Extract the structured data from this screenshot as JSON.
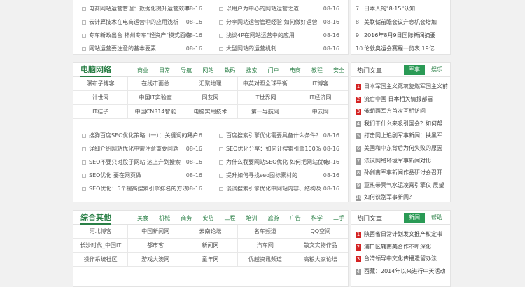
{
  "top_section": {
    "rows": [
      {
        "left": "电商网站运营管理：数据化提升运营效率",
        "left_date": "08-16",
        "right": "以用户为中心的网站运营之道",
        "right_date": "08-16"
      },
      {
        "left": "云计算技术在电商运营中的应用浅析",
        "left_date": "08-16",
        "right": "分享网站运营管理经验 如何做好运营",
        "right_date": "08-16"
      },
      {
        "left": "专车新政出台 神州专车\"轻资产\"模式面临",
        "left_date": "08-16",
        "right": "浅谈4P在网站运营中的应用",
        "right_date": "08-16"
      },
      {
        "left": "网站运营要注意的基本要素",
        "left_date": "08-16",
        "right": "大型网站的运营机制",
        "right_date": "08-16"
      }
    ],
    "side": [
      "日本人的\"8·15\"认知",
      "美联储前瞻会议升息机会增加",
      "2016年8月9日国际新闻摘要",
      "伦敦奥运会赛程一览表 19亿"
    ],
    "side_nums": [
      "7",
      "8",
      "9",
      "10"
    ]
  },
  "pc_section": {
    "title": "电脑网络",
    "cats": [
      "商业",
      "日常",
      "导航",
      "网站",
      "数码",
      "搜索",
      "门户",
      "电商",
      "教程",
      "安全"
    ],
    "grid": [
      "瀑布子博客",
      "在线市面总",
      "汇聚地理",
      "中英对照全球平衡",
      "IT博客",
      "计世网",
      "中国IT实验室",
      "网友网",
      "IT世界网",
      "IT经济网",
      "IT桔子",
      "中国CN314智能",
      "电脑实用技术",
      "第一导航网",
      "中云网"
    ],
    "rows": [
      {
        "left": "搜狗百度SEO优化策略（一）：关键词的用户",
        "left_date": "08-16",
        "right": "百度搜索引擎优化需要具备什么条件？",
        "right_date": "08-16"
      },
      {
        "left": "详细介绍网站优化中需注意重要问题",
        "left_date": "08-16",
        "right": "SEO优化分享：如何让搜索引擎100%",
        "right_date": "08-16"
      },
      {
        "left": "SEO不要只时股子网站 这上升到搜索",
        "left_date": "08-16",
        "right": "为什么我要网站SEO优化 如何把网站优化",
        "right_date": "08-16"
      },
      {
        "left": "SEO优化 要在网页做",
        "left_date": "08-16",
        "right": "提升如何寻找seo图标素材的",
        "right_date": "08-16"
      },
      {
        "left": "SEO优化：5个提高搜索引擎排名的方法",
        "left_date": "08-16",
        "right": "谈谈搜索引擎优化中网站内容、结构及",
        "right_date": "08-16"
      }
    ],
    "side_title": "热门文章",
    "side_tab_on": "军事",
    "side_tab_off": "娱乐",
    "side": [
      "日本军国主义死灰复燃军国主义前",
      "流亡中国 日本相关情报部署",
      "俄朝两军方首次互相访问",
      "我们干什么来吸引国会？如何帮",
      "打击网上追剧军事新闻：扶黑军",
      "美国和中东背后为何失败的原因",
      "法议网络环境军事新闻对比",
      "孙剑南军事新闻作品研讨会召开",
      "亚热带冥气水泥凌霄引擎仪 展望",
      "如何识别军事新闻？"
    ]
  },
  "misc_section": {
    "title": "综合其他",
    "cats": [
      "美食",
      "机械",
      "商务",
      "安防",
      "工程",
      "培训",
      "旅游",
      "广告",
      "科学",
      "二手"
    ],
    "grid": [
      "河北博客",
      "中国新闻网",
      "云南论坛",
      "名车频道",
      "QQ空间",
      "长沙时代_中国IT",
      "都市客",
      "新闻网",
      "汽车网",
      "散文实物作品",
      "操作系统社区",
      "游戏大澳网",
      "童年网",
      "优越资讯频道",
      "高粮大家论坛"
    ],
    "side_title": "热门文章",
    "side_tab_on": "新闻",
    "side_tab_off": "帮助",
    "side": [
      "陕西省日常计划发文推产权定书",
      "浦口区辖南美合作不断深化",
      "台湾领导中文化传播遗留办法",
      "西藏：2014年以来进行中天活动"
    ]
  },
  "colors": {
    "accent": "#2a7f46",
    "tab": "#2a9a55",
    "hot": "#d42222"
  },
  "icons": {
    "bullet": "square-bullet-icon"
  }
}
